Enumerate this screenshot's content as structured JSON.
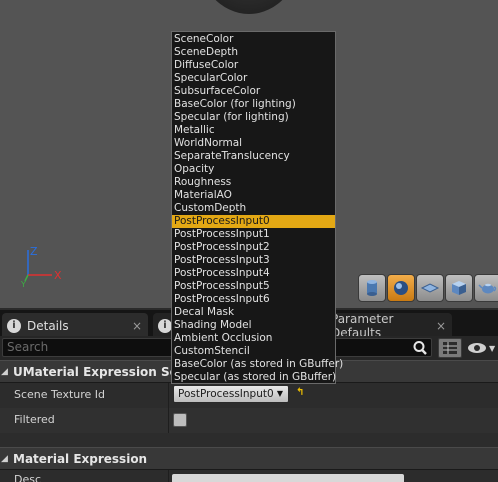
{
  "viewport": {
    "axis": {
      "z": "Z",
      "x": "X",
      "y": "Y"
    },
    "toolbar": [
      {
        "name": "cylinder-preview-icon",
        "active": false
      },
      {
        "name": "sphere-preview-icon",
        "active": true
      },
      {
        "name": "plane-preview-icon",
        "active": false
      },
      {
        "name": "cube-preview-icon",
        "active": false
      },
      {
        "name": "teapot-preview-icon",
        "active": false
      }
    ]
  },
  "tabs": [
    {
      "label": "Details",
      "close": "×"
    },
    {
      "label": "",
      "close": ""
    },
    {
      "label": "Parameter Defaults",
      "close": "×"
    }
  ],
  "search": {
    "placeholder": "Search"
  },
  "details": {
    "category1": "UMaterial Expression Scene",
    "scene_texture_label": "Scene Texture Id",
    "scene_texture_value": "PostProcessInput0",
    "filtered_label": "Filtered",
    "filtered_checked": false,
    "category2": "Material Expression",
    "desc_label": "Desc"
  },
  "menu": {
    "selected_index": 14,
    "items": [
      "SceneColor",
      "SceneDepth",
      "DiffuseColor",
      "SpecularColor",
      "SubsurfaceColor",
      "BaseColor (for lighting)",
      "Specular (for lighting)",
      "Metallic",
      "WorldNormal",
      "SeparateTranslucency",
      "Opacity",
      "Roughness",
      "MaterialAO",
      "CustomDepth",
      "PostProcessInput0",
      "PostProcessInput1",
      "PostProcessInput2",
      "PostProcessInput3",
      "PostProcessInput4",
      "PostProcessInput5",
      "PostProcessInput6",
      "Decal Mask",
      "Shading Model",
      "Ambient Occlusion",
      "CustomStencil",
      "BaseColor (as stored in GBuffer)",
      "Specular (as stored in GBuffer)"
    ]
  },
  "colors": {
    "accent": "#e3a814",
    "viewport_bg": "#545454",
    "axis_x": "#e03030",
    "axis_z": "#2a6fe0",
    "axis_y": "#3cb043"
  }
}
